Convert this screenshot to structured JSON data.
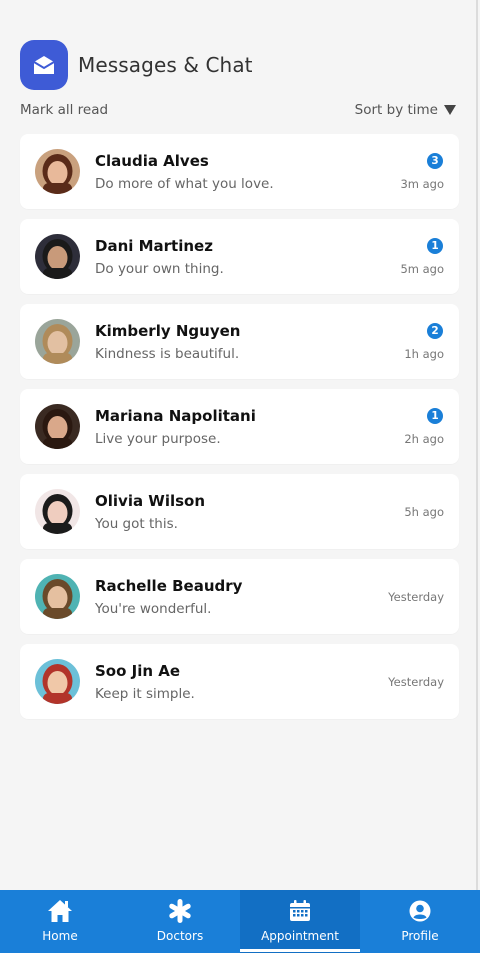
{
  "header": {
    "title": "Messages & Chat",
    "icon": "envelope-icon"
  },
  "toolbar": {
    "mark_all_read": "Mark all read",
    "sort_label": "Sort by time",
    "sort_icon": "triangle-down-icon"
  },
  "conversations": [
    {
      "name": "Claudia Alves",
      "preview": "Do more of what you love.",
      "time": "3m ago",
      "unread": "3",
      "avatar_bg": "#c9a17e",
      "avatar_hair": "#5a2b19",
      "avatar_skin": "#e8b99a"
    },
    {
      "name": "Dani Martinez",
      "preview": "Do your own thing.",
      "time": "5m ago",
      "unread": "1",
      "avatar_bg": "#2e2e3a",
      "avatar_hair": "#1a1a1a",
      "avatar_skin": "#c89a7a"
    },
    {
      "name": "Kimberly Nguyen",
      "preview": "Kindness is beautiful.",
      "time": "1h ago",
      "unread": "2",
      "avatar_bg": "#9aa59a",
      "avatar_hair": "#b08b5a",
      "avatar_skin": "#e2c0a2"
    },
    {
      "name": "Mariana Napolitani",
      "preview": "Live your purpose.",
      "time": "2h ago",
      "unread": "1",
      "avatar_bg": "#3a2a22",
      "avatar_hair": "#2a1810",
      "avatar_skin": "#d9a88a"
    },
    {
      "name": "Olivia Wilson",
      "preview": "You got this.",
      "time": "5h ago",
      "unread": "",
      "avatar_bg": "#f1e6e6",
      "avatar_hair": "#1b1b1b",
      "avatar_skin": "#efcdbf"
    },
    {
      "name": "Rachelle Beaudry",
      "preview": "You're wonderful.",
      "time": "Yesterday",
      "unread": "",
      "avatar_bg": "#4fb3b3",
      "avatar_hair": "#6a4a2a",
      "avatar_skin": "#e5c0a0"
    },
    {
      "name": "Soo Jin Ae",
      "preview": "Keep it simple.",
      "time": "Yesterday",
      "unread": "",
      "avatar_bg": "#6cc0d8",
      "avatar_hair": "#b2342a",
      "avatar_skin": "#f0c8a8"
    }
  ],
  "nav": {
    "items": [
      {
        "label": "Home",
        "icon": "home-icon"
      },
      {
        "label": "Doctors",
        "icon": "asterisk-icon"
      },
      {
        "label": "Appointment",
        "icon": "calendar-icon"
      },
      {
        "label": "Profile",
        "icon": "user-circle-icon"
      }
    ],
    "active": "Appointment"
  },
  "colors": {
    "accent": "#1a7fd8",
    "header_icon": "#3e5bd6",
    "background": "#f5f5f5"
  }
}
